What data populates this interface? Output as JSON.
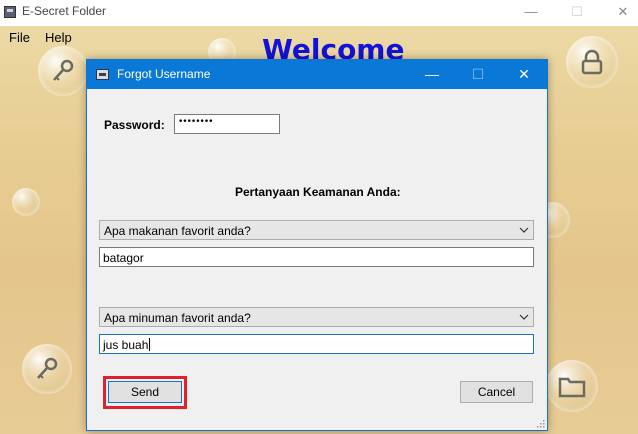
{
  "main_window": {
    "title": "E-Secret Folder",
    "controls": {
      "minimize": "—",
      "maximize": "☐",
      "close": "✕"
    },
    "menu": [
      "File",
      "Help"
    ],
    "welcome_text": "Welcome"
  },
  "dialog": {
    "title": "Forgot Username",
    "controls": {
      "minimize": "—",
      "maximize": "☐",
      "close": "✕"
    },
    "password_label": "Password:",
    "password_value": "••••••••",
    "security_heading": "Pertanyaan Keamanan Anda:",
    "question_1": "Apa makanan favorit anda?",
    "answer_1": "batagor",
    "question_2": "Apa minuman favorit anda?",
    "answer_2": "jus buah",
    "send_label": "Send",
    "cancel_label": "Cancel"
  },
  "colors": {
    "dialog_titlebar": "#0a78d7",
    "welcome": "#1212d8",
    "highlight": "#e0202a"
  }
}
